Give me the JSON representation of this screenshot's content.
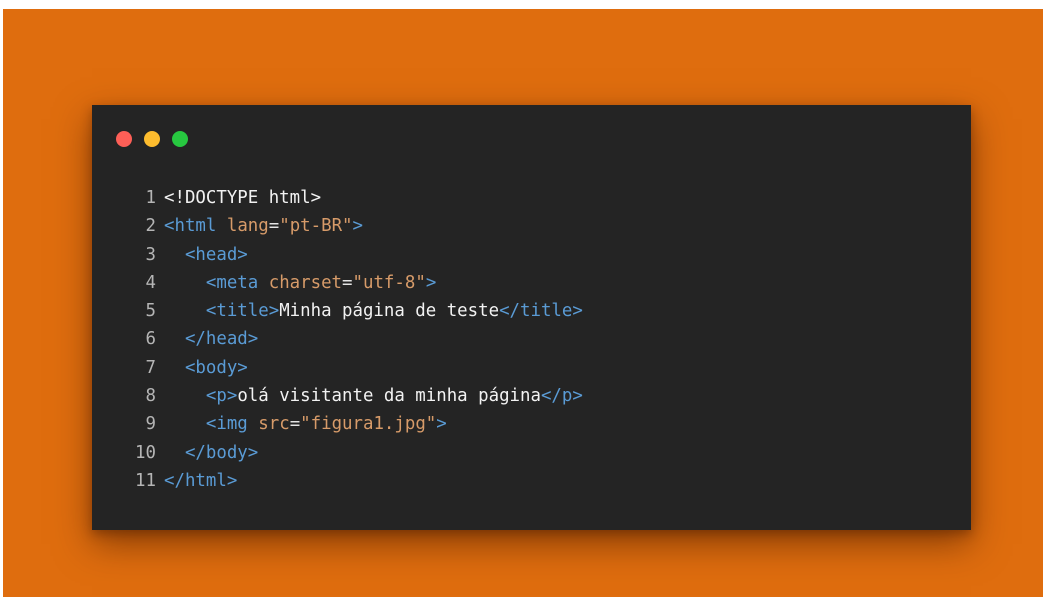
{
  "colors": {
    "background_orange": "#df6d0e",
    "window_bg": "#242424",
    "close_dot": "#fd5f57",
    "minimize_dot": "#fdbc2e",
    "zoom_dot": "#27c840",
    "line_number": "#b5b5b5",
    "plain_text": "#f2f2f2",
    "tag": "#5a9bd5",
    "attribute": "#d79b69",
    "punctuation": "#e4e4e4"
  },
  "window": {
    "controls": [
      "close-icon",
      "minimize-icon",
      "zoom-icon"
    ]
  },
  "code": {
    "lines": [
      {
        "number": "1",
        "indent": "",
        "tokens": [
          {
            "text": "<!DOCTYPE html>",
            "kind": "plain"
          }
        ]
      },
      {
        "number": "2",
        "indent": "",
        "tokens": [
          {
            "text": "<html",
            "kind": "tag"
          },
          {
            "text": " ",
            "kind": "plain"
          },
          {
            "text": "lang",
            "kind": "attr"
          },
          {
            "text": "=",
            "kind": "punct"
          },
          {
            "text": "\"pt-BR\"",
            "kind": "attr"
          },
          {
            "text": ">",
            "kind": "tag"
          }
        ]
      },
      {
        "number": "3",
        "indent": "  ",
        "tokens": [
          {
            "text": "<head>",
            "kind": "tag"
          }
        ]
      },
      {
        "number": "4",
        "indent": "    ",
        "tokens": [
          {
            "text": "<meta",
            "kind": "tag"
          },
          {
            "text": " ",
            "kind": "plain"
          },
          {
            "text": "charset",
            "kind": "attr"
          },
          {
            "text": "=",
            "kind": "punct"
          },
          {
            "text": "\"utf-8\"",
            "kind": "attr"
          },
          {
            "text": ">",
            "kind": "tag"
          }
        ]
      },
      {
        "number": "5",
        "indent": "    ",
        "tokens": [
          {
            "text": "<title>",
            "kind": "tag"
          },
          {
            "text": "Minha página de teste",
            "kind": "plain"
          },
          {
            "text": "</title>",
            "kind": "tag"
          }
        ]
      },
      {
        "number": "6",
        "indent": "  ",
        "tokens": [
          {
            "text": "</head>",
            "kind": "tag"
          }
        ]
      },
      {
        "number": "7",
        "indent": "  ",
        "tokens": [
          {
            "text": "<body>",
            "kind": "tag"
          }
        ]
      },
      {
        "number": "8",
        "indent": "    ",
        "tokens": [
          {
            "text": "<p>",
            "kind": "tag"
          },
          {
            "text": "olá visitante da minha página",
            "kind": "plain"
          },
          {
            "text": "</p>",
            "kind": "tag"
          }
        ]
      },
      {
        "number": "9",
        "indent": "    ",
        "tokens": [
          {
            "text": "<img",
            "kind": "tag"
          },
          {
            "text": " ",
            "kind": "plain"
          },
          {
            "text": "src",
            "kind": "attr"
          },
          {
            "text": "=",
            "kind": "punct"
          },
          {
            "text": "\"figura1.jpg\"",
            "kind": "attr"
          },
          {
            "text": ">",
            "kind": "tag"
          }
        ]
      },
      {
        "number": "10",
        "indent": "  ",
        "tokens": [
          {
            "text": "</body>",
            "kind": "tag"
          }
        ]
      },
      {
        "number": "11",
        "indent": "",
        "tokens": [
          {
            "text": "</html>",
            "kind": "tag"
          }
        ]
      }
    ]
  }
}
